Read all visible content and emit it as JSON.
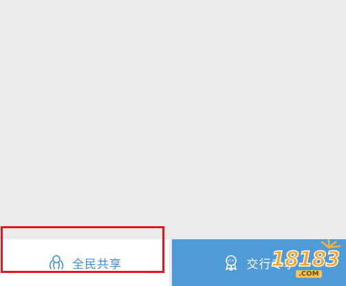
{
  "tabs": [
    {
      "id": "share",
      "label": "全民共享",
      "icon": "people-share-icon",
      "active": true
    },
    {
      "id": "vip",
      "label": "交行专享",
      "icon": "vip-badge-icon",
      "active": false
    }
  ],
  "colors": {
    "background": "#ebebeb",
    "share_tab_text": "#3d8fd1",
    "vip_tab_bg": "#4e9bd8",
    "highlight": "#e8141a",
    "watermark": "#f4a32a"
  },
  "watermark": {
    "text": "18183",
    "suffix": ".COM"
  }
}
